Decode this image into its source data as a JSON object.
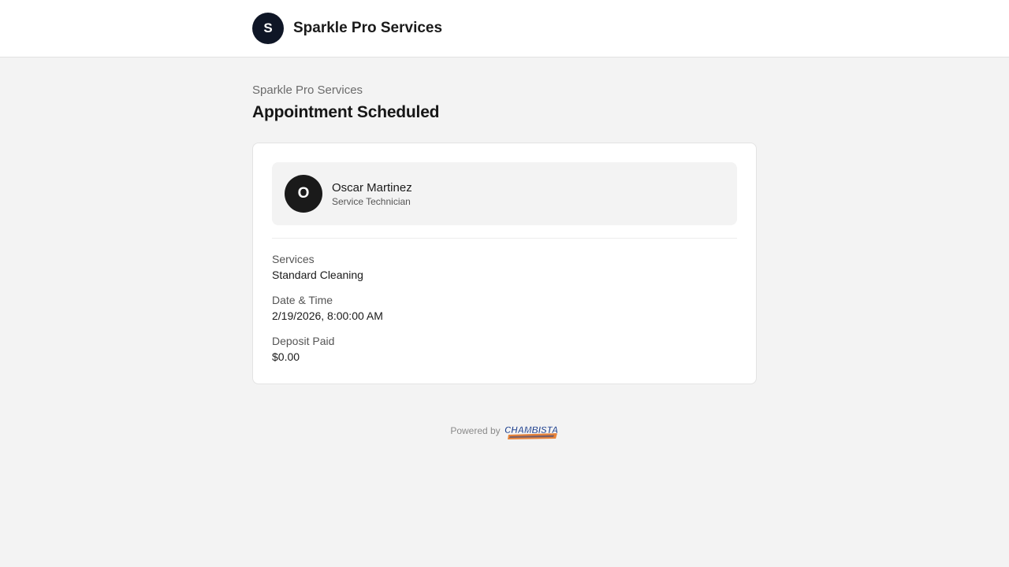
{
  "header": {
    "avatar_letter": "S",
    "business_name": "Sparkle Pro Services"
  },
  "page": {
    "breadcrumb": "Sparkle Pro Services",
    "title": "Appointment Scheduled"
  },
  "staff": {
    "avatar_letter": "O",
    "name": "Oscar Martinez",
    "role": "Service Technician"
  },
  "details": [
    {
      "label": "Services",
      "value": "Standard Cleaning"
    },
    {
      "label": "Date & Time",
      "value": "2/19/2026, 8:00:00 AM"
    },
    {
      "label": "Deposit Paid",
      "value": "$0.00"
    }
  ],
  "footer": {
    "powered_by": "Powered by",
    "logo_text": "CHAMBISTA",
    "logo_icon": "chambista-logo"
  },
  "colors": {
    "brand_avatar": "#0f1626",
    "staff_avatar": "#1a1a1a",
    "logo_orange": "#e8843a",
    "logo_blue": "#1e3f8a",
    "page_background": "#f3f3f3"
  }
}
